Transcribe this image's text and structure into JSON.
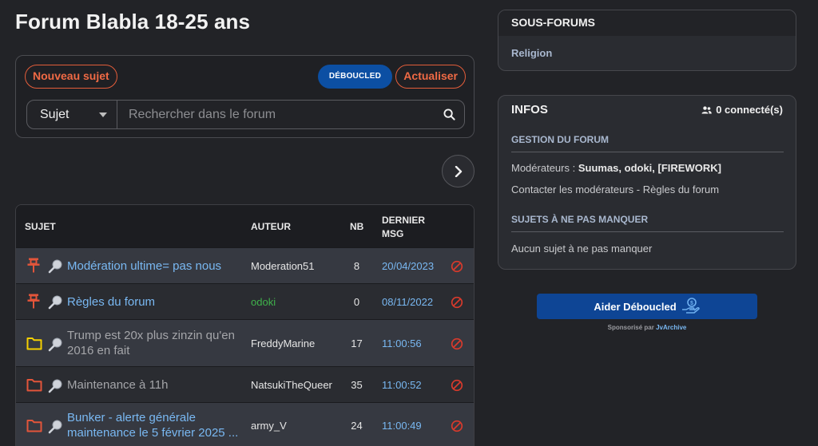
{
  "page": {
    "title": "Forum Blabla 18-25 ans"
  },
  "toolbar": {
    "new_topic_label": "Nouveau sujet",
    "deboucled_label": "DÉBOUCLED",
    "refresh_label": "Actualiser"
  },
  "search": {
    "select_value": "Sujet",
    "placeholder": "Rechercher dans le forum"
  },
  "table": {
    "headers": {
      "subject": "SUJET",
      "author": "AUTEUR",
      "count": "NB",
      "last_line1": "DERNIER",
      "last_line2": "MSG"
    },
    "rows": [
      {
        "icon": "pin-icon",
        "subject": "Modération ultime= pas nous",
        "author": "Moderation51",
        "count": "8",
        "last": "20/04/2023"
      },
      {
        "icon": "pin-icon",
        "subject": "Règles du forum",
        "author": "odoki",
        "count": "0",
        "last": "08/11/2022"
      },
      {
        "icon": "folder-yellow-icon",
        "subject": "Trump est 20x plus zinzin qu'en 2016 en fait",
        "author": "FreddyMarine",
        "count": "17",
        "last": "11:00:56"
      },
      {
        "icon": "folder-red-icon",
        "subject": "Maintenance à 11h",
        "author": "NatsukiTheQueer",
        "count": "35",
        "last": "11:00:52"
      },
      {
        "icon": "folder-red-icon",
        "subject": "Bunker - alerte générale maintenance le 5 février 2025 ...",
        "author": "army_V",
        "count": "24",
        "last": "11:00:49"
      }
    ]
  },
  "sous_forums": {
    "title": "SOUS-FORUMS",
    "items": [
      "Religion"
    ]
  },
  "infos": {
    "title": "INFOS",
    "online": "0 connecté(s)",
    "gestion_title": "GESTION DU FORUM",
    "moderators_label": "Modérateurs :",
    "moderators": "Suumas, odoki, [FIREWORK]",
    "contact": "Contacter les modérateurs - Règles du forum",
    "ne_pas_manquer_title": "SUJETS À NE PAS MANQUER",
    "ne_pas_manquer_text": "Aucun sujet à ne pas manquer"
  },
  "aider": {
    "label": "Aider Déboucled",
    "sponsor_prefix": "Sponsorisé par",
    "sponsor_brand": "JvArchive"
  },
  "colors": {
    "accent_orange": "#f06a45",
    "brand_blue": "#0c4fa3",
    "link_blue": "#79b8f2",
    "pin_red": "#e3553a",
    "folder_yellow": "#f5d000",
    "ban_red": "#d83a2c",
    "author_green": "#3fb24b"
  }
}
